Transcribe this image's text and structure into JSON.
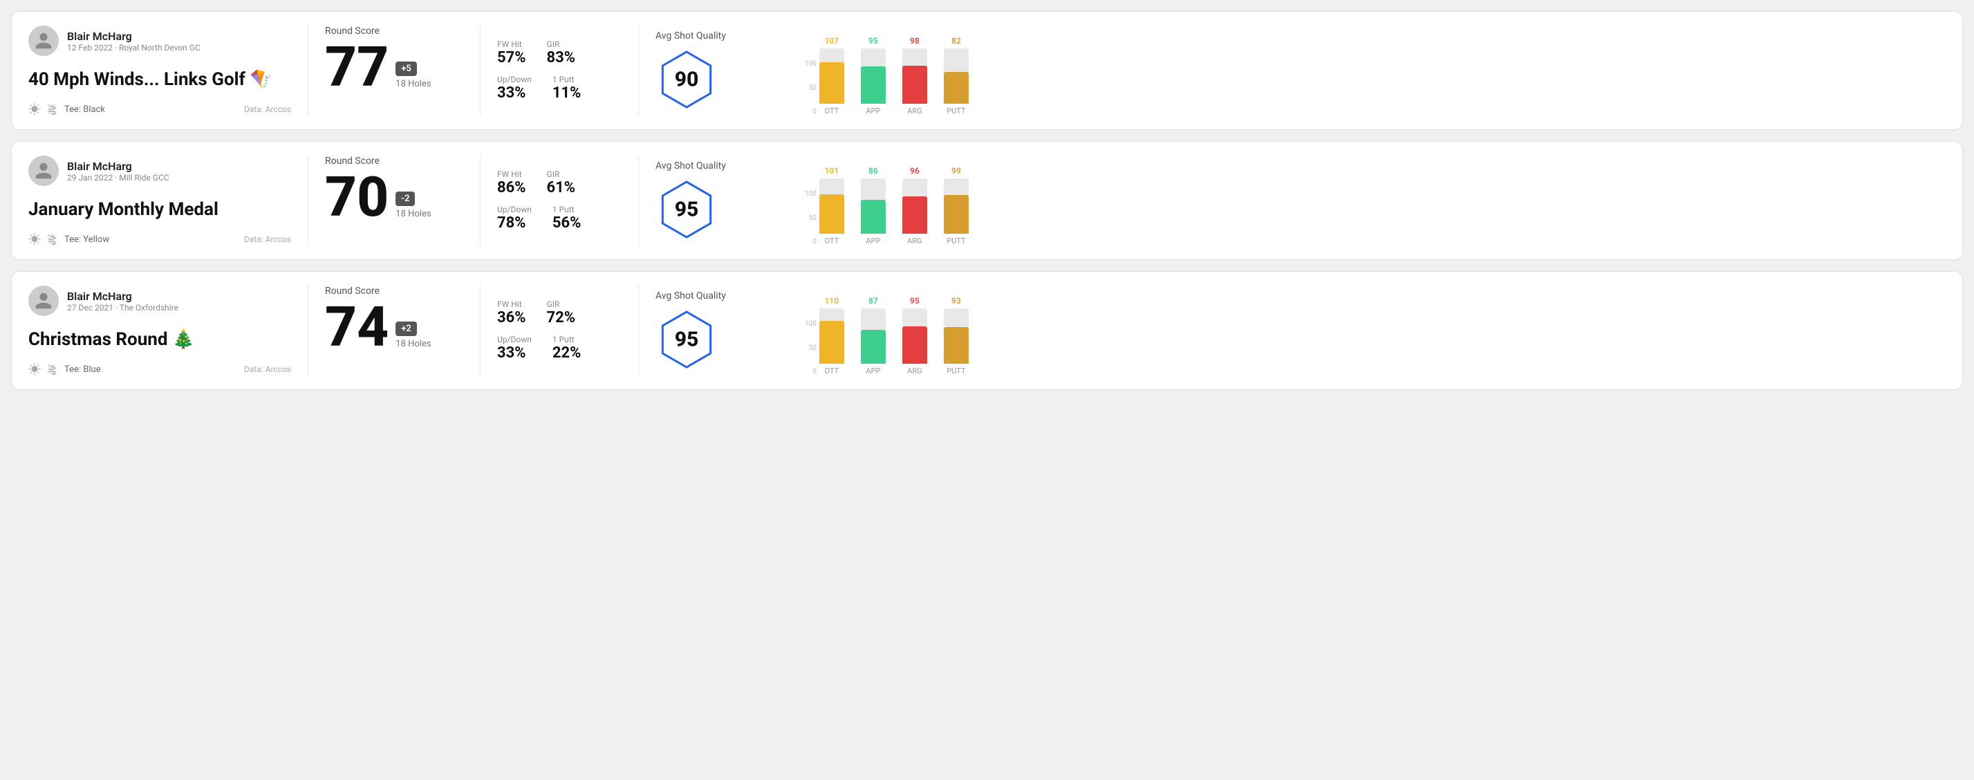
{
  "rounds": [
    {
      "id": "round1",
      "player_name": "Blair McHarg",
      "round_meta": "12 Feb 2022 · Royal North Devon GC",
      "round_title": "40 Mph Winds... Links Golf",
      "round_title_emoji": "🪁",
      "tee": "Black",
      "data_source": "Data: Arccos",
      "score": "77",
      "score_diff": "+5",
      "score_diff_type": "positive",
      "holes": "18 Holes",
      "fw_hit": "57%",
      "gir": "83%",
      "up_down": "33%",
      "one_putt": "11%",
      "avg_shot_quality": "90",
      "chart": {
        "ott": {
          "value": 107,
          "height_pct": 75,
          "color_class": "fill-ott",
          "text_class": "color-ott"
        },
        "app": {
          "value": 95,
          "height_pct": 67,
          "color_class": "fill-app",
          "text_class": "color-app"
        },
        "arg": {
          "value": 98,
          "height_pct": 69,
          "color_class": "fill-arg",
          "text_class": "color-arg"
        },
        "putt": {
          "value": 82,
          "height_pct": 58,
          "color_class": "fill-putt",
          "text_class": "color-putt"
        }
      }
    },
    {
      "id": "round2",
      "player_name": "Blair McHarg",
      "round_meta": "29 Jan 2022 · Mill Ride GCC",
      "round_title": "January Monthly Medal",
      "round_title_emoji": "",
      "tee": "Yellow",
      "data_source": "Data: Arccos",
      "score": "70",
      "score_diff": "-2",
      "score_diff_type": "negative",
      "holes": "18 Holes",
      "fw_hit": "86%",
      "gir": "61%",
      "up_down": "78%",
      "one_putt": "56%",
      "avg_shot_quality": "95",
      "chart": {
        "ott": {
          "value": 101,
          "height_pct": 71,
          "color_class": "fill-ott",
          "text_class": "color-ott"
        },
        "app": {
          "value": 86,
          "height_pct": 61,
          "color_class": "fill-app",
          "text_class": "color-app"
        },
        "arg": {
          "value": 96,
          "height_pct": 68,
          "color_class": "fill-arg",
          "text_class": "color-arg"
        },
        "putt": {
          "value": 99,
          "height_pct": 70,
          "color_class": "fill-putt",
          "text_class": "color-putt"
        }
      }
    },
    {
      "id": "round3",
      "player_name": "Blair McHarg",
      "round_meta": "27 Dec 2021 · The Oxfordshire",
      "round_title": "Christmas Round",
      "round_title_emoji": "🎄",
      "tee": "Blue",
      "data_source": "Data: Arccos",
      "score": "74",
      "score_diff": "+2",
      "score_diff_type": "positive",
      "holes": "18 Holes",
      "fw_hit": "36%",
      "gir": "72%",
      "up_down": "33%",
      "one_putt": "22%",
      "avg_shot_quality": "95",
      "chart": {
        "ott": {
          "value": 110,
          "height_pct": 78,
          "color_class": "fill-ott",
          "text_class": "color-ott"
        },
        "app": {
          "value": 87,
          "height_pct": 61,
          "color_class": "fill-app",
          "text_class": "color-app"
        },
        "arg": {
          "value": 95,
          "height_pct": 67,
          "color_class": "fill-arg",
          "text_class": "color-arg"
        },
        "putt": {
          "value": 93,
          "height_pct": 66,
          "color_class": "fill-putt",
          "text_class": "color-putt"
        }
      }
    }
  ],
  "labels": {
    "round_score": "Round Score",
    "fw_hit": "FW Hit",
    "gir": "GIR",
    "up_down": "Up/Down",
    "one_putt": "1 Putt",
    "avg_shot_quality": "Avg Shot Quality",
    "tee_prefix": "Tee:",
    "ott": "OTT",
    "app": "APP",
    "arg": "ARG",
    "putt": "PUTT",
    "axis_100": "100",
    "axis_50": "50",
    "axis_0": "0"
  }
}
